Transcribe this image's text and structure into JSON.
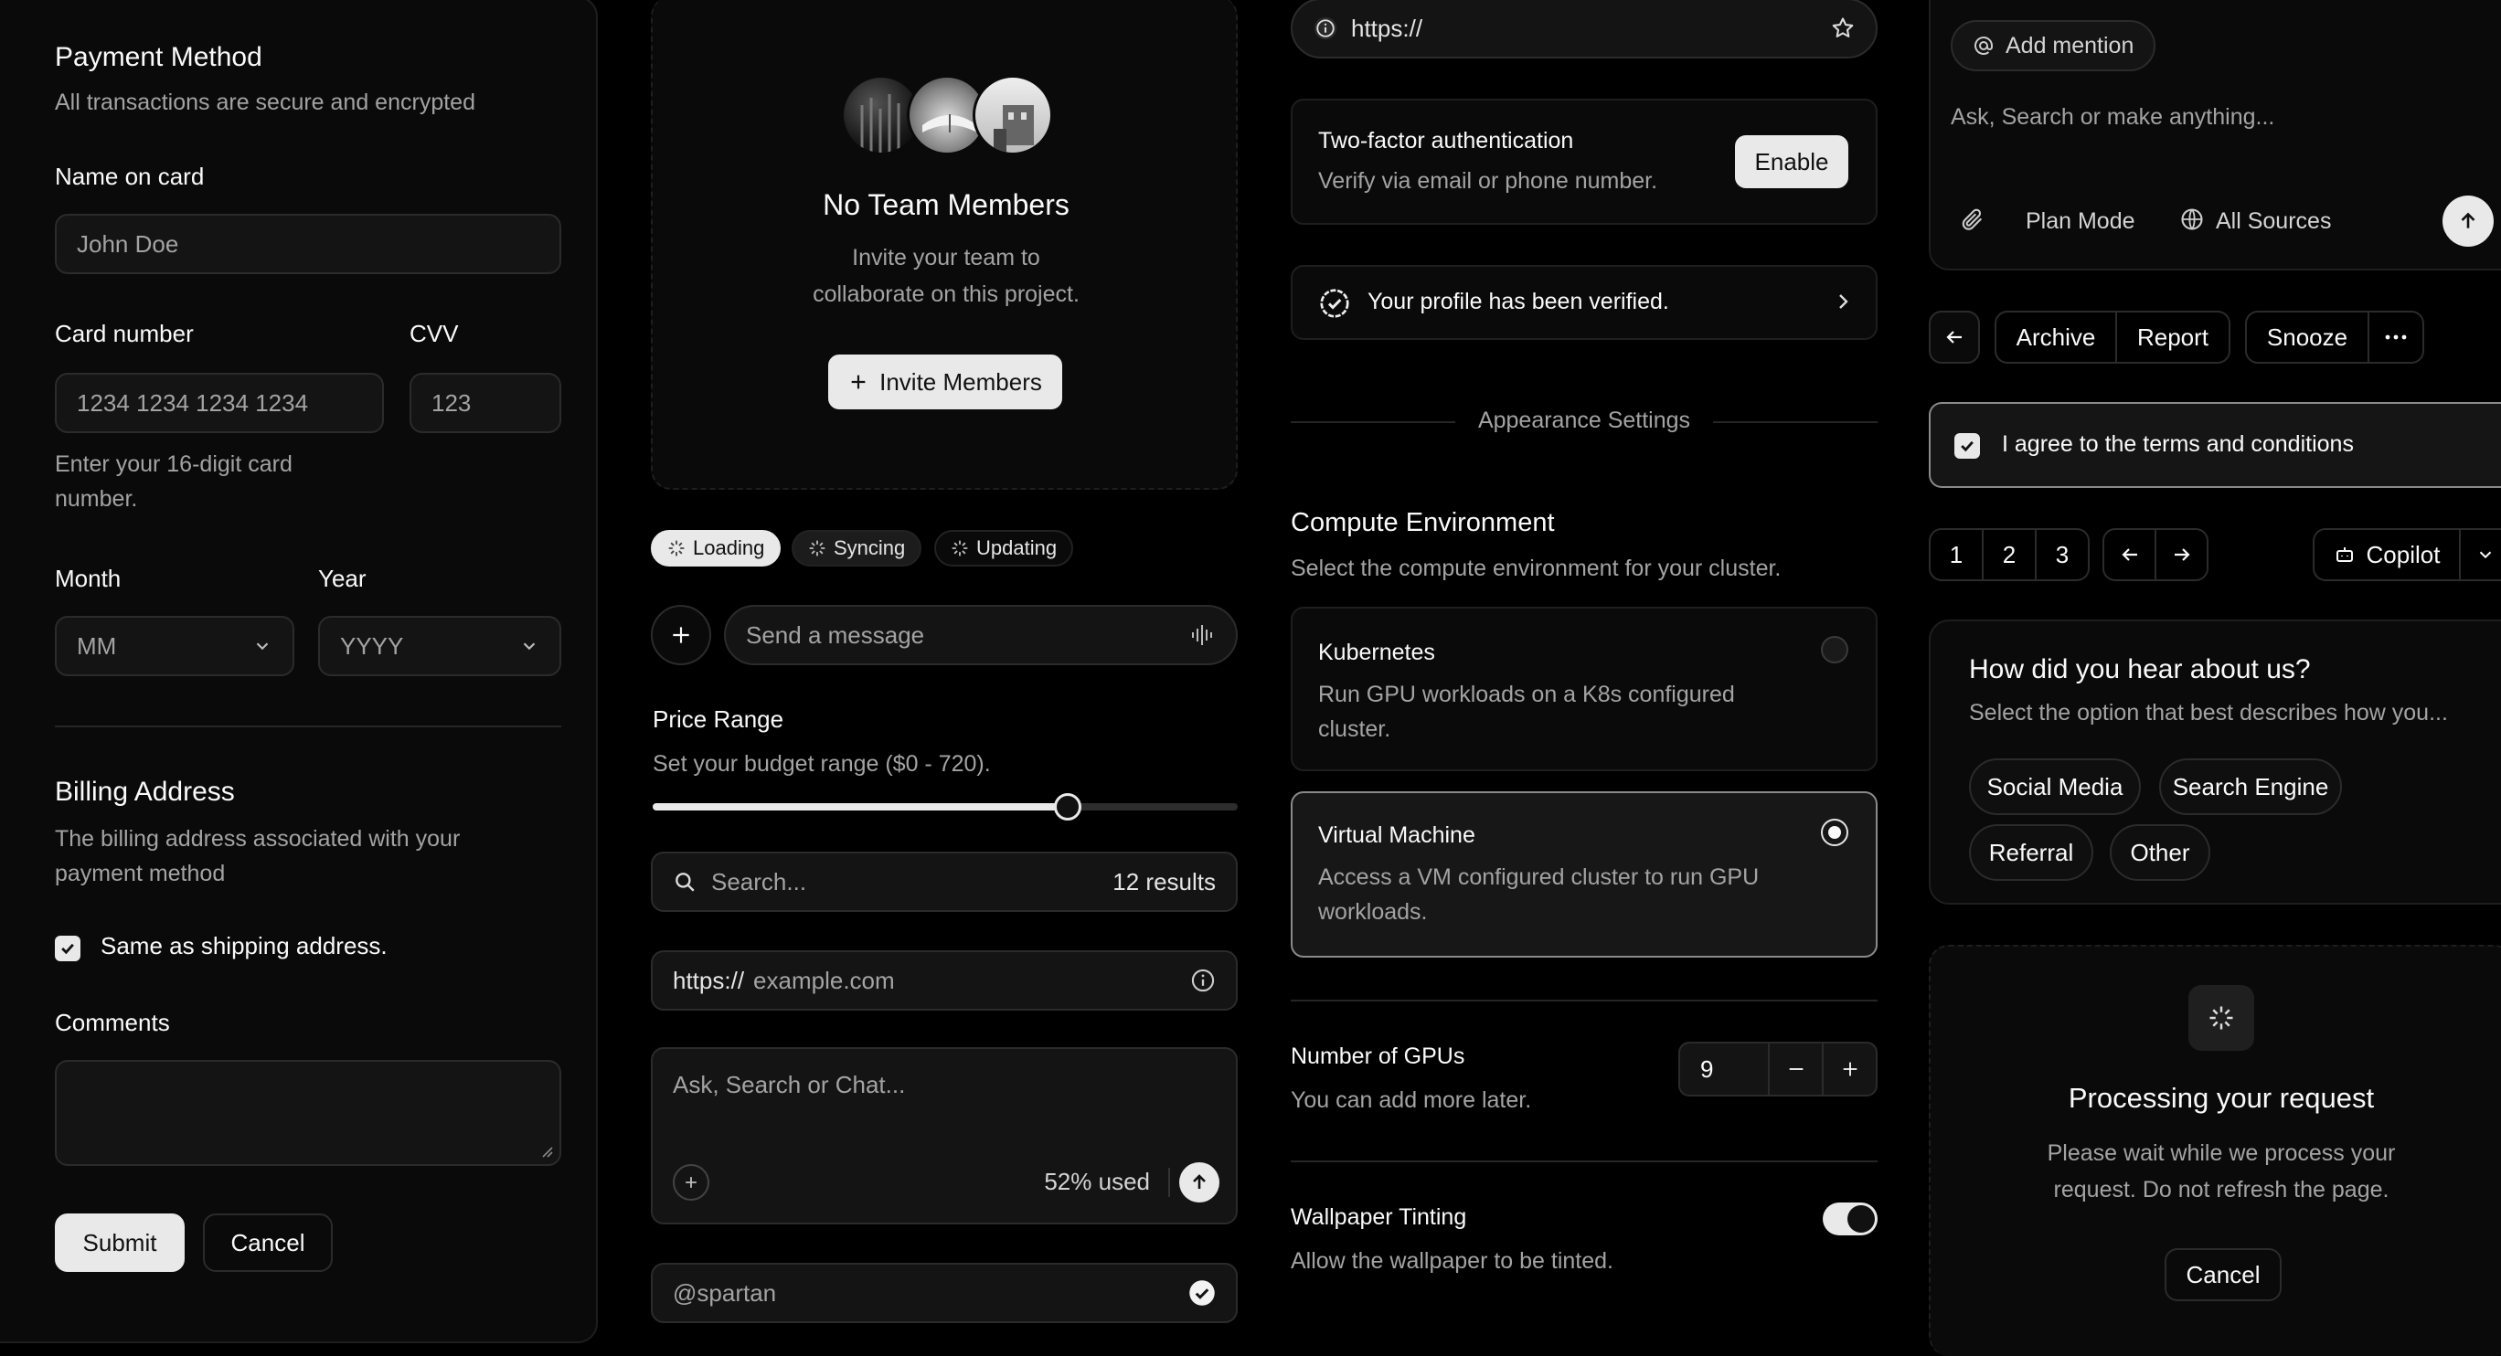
{
  "payment": {
    "title": "Payment Method",
    "subtitle": "All transactions are secure and encrypted",
    "name_label": "Name on card",
    "name_placeholder": "John Doe",
    "card_label": "Card number",
    "card_placeholder": "1234 1234 1234 1234",
    "cvv_label": "CVV",
    "cvv_placeholder": "123",
    "card_help_1": "Enter your 16-digit card",
    "card_help_2": "number.",
    "month_label": "Month",
    "month_value": "MM",
    "year_label": "Year",
    "year_value": "YYYY",
    "billing_title": "Billing Address",
    "billing_sub_1": "The billing address associated with your",
    "billing_sub_2": "payment method",
    "same_label": "Same as shipping address.",
    "comments_label": "Comments",
    "submit": "Submit",
    "cancel": "Cancel"
  },
  "team": {
    "title": "No Team Members",
    "desc_1": "Invite your team to",
    "desc_2": "collaborate on this project.",
    "invite": "Invite Members"
  },
  "status_chips": [
    "Loading",
    "Syncing",
    "Updating"
  ],
  "message": {
    "placeholder": "Send a message"
  },
  "price": {
    "title": "Price Range",
    "subtitle": "Set your budget range ($0 - 720).",
    "fraction": 0.71
  },
  "search": {
    "placeholder": "Search...",
    "results": "12 results"
  },
  "url_input": {
    "prefix": "https://",
    "placeholder": "example.com"
  },
  "chat": {
    "placeholder": "Ask, Search or Chat...",
    "usage": "52% used"
  },
  "username": {
    "value": "@spartan"
  },
  "top_url": {
    "value": "https://"
  },
  "twofa": {
    "title": "Two-factor authentication",
    "desc": "Verify via email or phone number.",
    "button": "Enable"
  },
  "verified": {
    "text": "Your profile has been verified."
  },
  "appearance": {
    "label": "Appearance Settings"
  },
  "compute": {
    "title": "Compute Environment",
    "subtitle": "Select the compute environment for your cluster.",
    "k8s_title": "Kubernetes",
    "k8s_desc_1": "Run GPU workloads on a K8s configured",
    "k8s_desc_2": "cluster.",
    "vm_title": "Virtual Machine",
    "vm_desc_1": "Access a VM configured cluster to run GPU",
    "vm_desc_2": "workloads."
  },
  "gpus": {
    "title": "Number of GPUs",
    "subtitle": "You can add more later.",
    "value": "9"
  },
  "wallpaper": {
    "title": "Wallpaper Tinting",
    "subtitle": "Allow the wallpaper to be tinted.",
    "on": true
  },
  "prompt": {
    "mention": "Add mention",
    "placeholder": "Ask, Search or make anything...",
    "plan": "Plan Mode",
    "sources": "All Sources"
  },
  "actions": {
    "archive": "Archive",
    "report": "Report",
    "snooze": "Snooze"
  },
  "terms": {
    "text": "I agree to the terms and conditions"
  },
  "pages": [
    "1",
    "2",
    "3"
  ],
  "copilot": {
    "label": "Copilot"
  },
  "survey": {
    "title": "How did you hear about us?",
    "subtitle": "Select the option that best describes how you...",
    "options": [
      "Social Media",
      "Search Engine",
      "Referral",
      "Other"
    ]
  },
  "processing": {
    "title": "Processing your request",
    "desc_1": "Please wait while we process your",
    "desc_2": "request. Do not refresh the page.",
    "cancel": "Cancel"
  },
  "colors": {
    "background": "#000000",
    "card": "#0a0a0a",
    "border": "#1e1e1e",
    "accent": "#e9e9e9"
  }
}
